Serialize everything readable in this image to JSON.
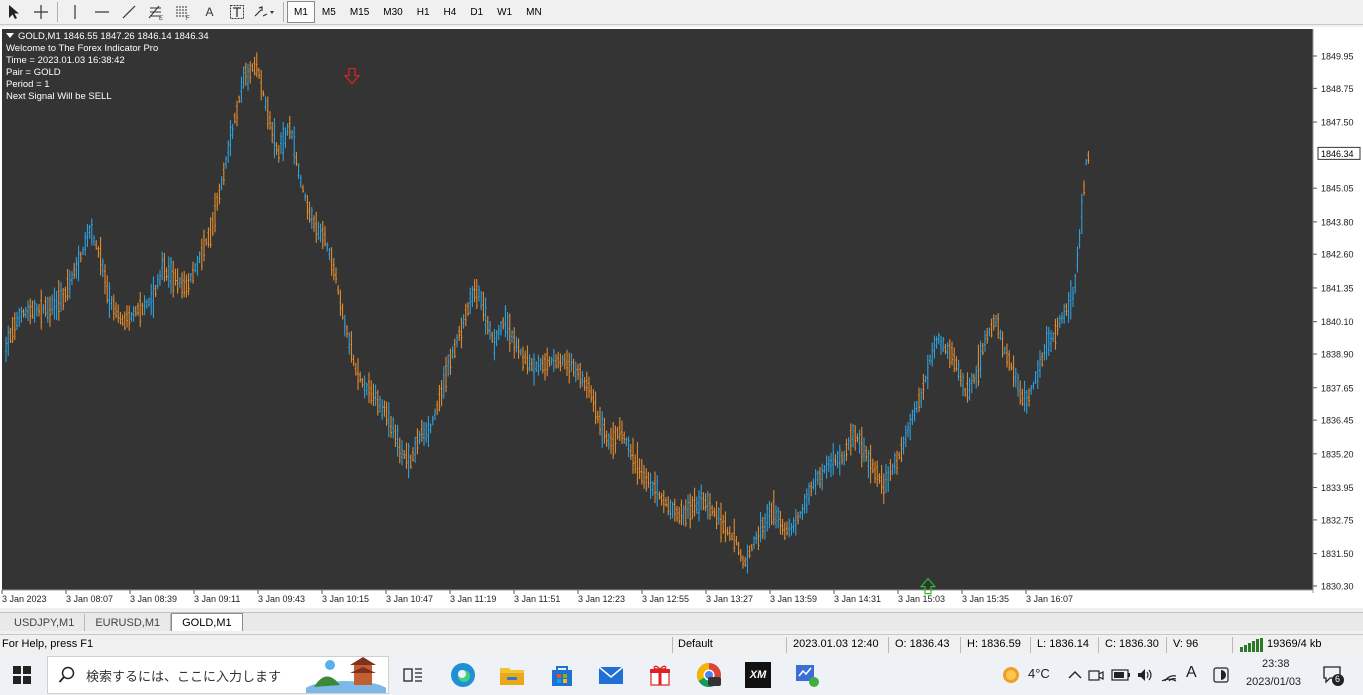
{
  "toolbar": {
    "tools": [
      "cursor-arrow-icon",
      "crosshair-icon",
      "vertical-line-icon",
      "horizontal-line-icon",
      "trendline-icon",
      "fibonacci-e-icon",
      "fibonacci-f-icon",
      "text-tool-icon",
      "label-tool-icon",
      "arrows-dropdown-icon"
    ],
    "text_tool_label": "A",
    "timeframes": [
      "M1",
      "M5",
      "M15",
      "M30",
      "H1",
      "H4",
      "D1",
      "W1",
      "MN"
    ],
    "active_timeframe": "M1"
  },
  "chart": {
    "header": "GOLD,M1  1846.55 1847.26 1846.14 1846.34",
    "info_lines": [
      "Welcome to The Forex Indicator Pro",
      "Time = 2023.01.03 16:38:42",
      "Pair = GOLD",
      "Period = 1",
      "Next Signal Will be SELL"
    ],
    "current_price": "1846.34",
    "colors": {
      "background": "#343434",
      "bull": "#2ea8e8",
      "bear": "#f0922e",
      "sell_arrow": "#e02020",
      "buy_arrow": "#22c022",
      "grid_text": "#ffffff"
    }
  },
  "chart_data": {
    "type": "candlestick",
    "title": "GOLD,M1",
    "y_ticks": [
      "1849.95",
      "1848.75",
      "1847.50",
      "1846.34",
      "1845.05",
      "1843.80",
      "1842.60",
      "1841.35",
      "1840.10",
      "1838.90",
      "1837.65",
      "1836.45",
      "1835.20",
      "1833.95",
      "1832.75",
      "1831.50",
      "1830.30"
    ],
    "x_ticks": [
      "3 Jan 2023",
      "3 Jan 08:07",
      "3 Jan 08:39",
      "3 Jan 09:11",
      "3 Jan 09:43",
      "3 Jan 10:15",
      "3 Jan 10:47",
      "3 Jan 11:19",
      "3 Jan 11:51",
      "3 Jan 12:23",
      "3 Jan 12:55",
      "3 Jan 13:27",
      "3 Jan 13:59",
      "3 Jan 14:31",
      "3 Jan 15:03",
      "3 Jan 15:35",
      "3 Jan 16:07"
    ],
    "ylim": [
      1830.3,
      1849.95
    ],
    "series_path": [
      [
        0,
        1838.5
      ],
      [
        8,
        1839.6
      ],
      [
        20,
        1840.4
      ],
      [
        45,
        1840.6
      ],
      [
        62,
        1841.0
      ],
      [
        78,
        1842.4
      ],
      [
        88,
        1843.5
      ],
      [
        98,
        1842.6
      ],
      [
        108,
        1840.8
      ],
      [
        122,
        1840.1
      ],
      [
        135,
        1840.5
      ],
      [
        150,
        1840.9
      ],
      [
        160,
        1842.0
      ],
      [
        172,
        1841.7
      ],
      [
        185,
        1841.4
      ],
      [
        198,
        1842.5
      ],
      [
        210,
        1843.6
      ],
      [
        220,
        1845.3
      ],
      [
        232,
        1847.5
      ],
      [
        242,
        1849.1
      ],
      [
        254,
        1849.7
      ],
      [
        265,
        1848.0
      ],
      [
        276,
        1846.3
      ],
      [
        288,
        1847.4
      ],
      [
        298,
        1845.4
      ],
      [
        310,
        1843.9
      ],
      [
        323,
        1843.2
      ],
      [
        333,
        1841.9
      ],
      [
        343,
        1840.0
      ],
      [
        353,
        1838.4
      ],
      [
        363,
        1837.7
      ],
      [
        375,
        1837.3
      ],
      [
        388,
        1836.4
      ],
      [
        398,
        1835.4
      ],
      [
        408,
        1834.8
      ],
      [
        418,
        1835.9
      ],
      [
        428,
        1836.1
      ],
      [
        438,
        1837.3
      ],
      [
        448,
        1838.7
      ],
      [
        458,
        1839.7
      ],
      [
        466,
        1840.6
      ],
      [
        474,
        1841.4
      ],
      [
        482,
        1840.5
      ],
      [
        492,
        1839.3
      ],
      [
        502,
        1840.1
      ],
      [
        512,
        1839.4
      ],
      [
        522,
        1838.8
      ],
      [
        532,
        1838.4
      ],
      [
        545,
        1838.6
      ],
      [
        558,
        1838.7
      ],
      [
        570,
        1838.5
      ],
      [
        580,
        1838.0
      ],
      [
        590,
        1837.4
      ],
      [
        598,
        1836.3
      ],
      [
        608,
        1835.6
      ],
      [
        618,
        1836.1
      ],
      [
        628,
        1835.3
      ],
      [
        640,
        1834.5
      ],
      [
        652,
        1833.9
      ],
      [
        664,
        1833.4
      ],
      [
        676,
        1832.9
      ],
      [
        690,
        1833.2
      ],
      [
        702,
        1833.5
      ],
      [
        714,
        1833.0
      ],
      [
        724,
        1832.4
      ],
      [
        734,
        1832.0
      ],
      [
        742,
        1831.1
      ],
      [
        752,
        1831.9
      ],
      [
        762,
        1832.5
      ],
      [
        772,
        1833.1
      ],
      [
        782,
        1832.4
      ],
      [
        792,
        1832.5
      ],
      [
        802,
        1833.2
      ],
      [
        812,
        1834.1
      ],
      [
        822,
        1834.6
      ],
      [
        832,
        1835.0
      ],
      [
        842,
        1835.1
      ],
      [
        852,
        1836.0
      ],
      [
        862,
        1835.3
      ],
      [
        872,
        1834.6
      ],
      [
        882,
        1834.1
      ],
      [
        892,
        1834.7
      ],
      [
        902,
        1835.6
      ],
      [
        912,
        1836.7
      ],
      [
        920,
        1837.4
      ],
      [
        928,
        1838.7
      ],
      [
        936,
        1839.5
      ],
      [
        944,
        1839.1
      ],
      [
        954,
        1838.6
      ],
      [
        964,
        1837.4
      ],
      [
        974,
        1838.1
      ],
      [
        984,
        1839.5
      ],
      [
        994,
        1840.1
      ],
      [
        1004,
        1838.9
      ],
      [
        1014,
        1838.0
      ],
      [
        1024,
        1837.0
      ],
      [
        1034,
        1838.0
      ],
      [
        1044,
        1839.2
      ],
      [
        1054,
        1839.7
      ],
      [
        1064,
        1840.6
      ],
      [
        1072,
        1841.0
      ],
      [
        1078,
        1843.3
      ],
      [
        1084,
        1846.0
      ],
      [
        1088,
        1846.34
      ]
    ],
    "signals": [
      {
        "type": "sell",
        "time": "3 Jan 10:15",
        "price": 1849.15
      },
      {
        "type": "buy",
        "time": "3 Jan 15:03",
        "price": 1830.35
      }
    ]
  },
  "tabs": [
    "USDJPY,M1",
    "EURUSD,M1",
    "GOLD,M1"
  ],
  "active_tab": "GOLD,M1",
  "status": {
    "help": "For Help, press F1",
    "profile": "Default",
    "datetime": "2023.01.03 12:40",
    "open": "O: 1836.43",
    "high": "H: 1836.59",
    "low": "L: 1836.14",
    "close": "C: 1836.30",
    "volume": "V: 96",
    "traffic": "19369/4 kb"
  },
  "taskbar": {
    "search_placeholder": "検索するには、ここに入力します",
    "apps": [
      "task-view-icon",
      "edge-icon",
      "file-explorer-icon",
      "store-icon",
      "mail-icon",
      "gift-app-icon",
      "chrome-icon",
      "xm-app-icon",
      "mt4-icon"
    ],
    "xm_label": "XM",
    "temperature": "4°C",
    "ime": "A",
    "time": "23:38",
    "date": "2023/01/03",
    "notification_count": "6"
  }
}
